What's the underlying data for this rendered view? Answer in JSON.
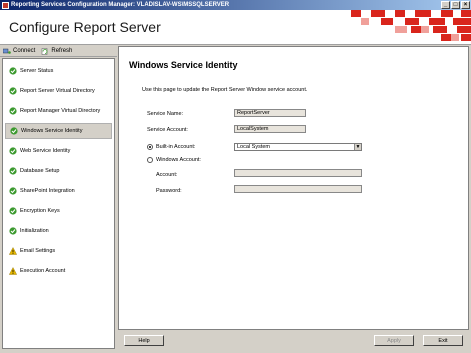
{
  "window": {
    "title": "Reporting Services Configuration Manager: VLADISLAV-WS\\MSSQLSERVER",
    "controls": {
      "minimize": "_",
      "maximize": "□",
      "close": "×"
    }
  },
  "header": {
    "title": "Configure Report Server"
  },
  "toolbar": {
    "connect_label": "Connect",
    "refresh_label": "Refresh"
  },
  "sidebar": {
    "items": [
      {
        "label": "Server Status",
        "icon": "check-icon",
        "status": "ok"
      },
      {
        "label": "Report Server Virtual Directory",
        "icon": "check-icon",
        "status": "ok"
      },
      {
        "label": "Report Manager Virtual Directory",
        "icon": "check-icon",
        "status": "ok"
      },
      {
        "label": "Windows Service Identity",
        "icon": "check-icon",
        "status": "ok",
        "active": true
      },
      {
        "label": "Web Service Identity",
        "icon": "check-icon",
        "status": "ok"
      },
      {
        "label": "Database Setup",
        "icon": "check-icon",
        "status": "ok"
      },
      {
        "label": "SharePoint Integration",
        "icon": "check-icon",
        "status": "ok"
      },
      {
        "label": "Encryption Keys",
        "icon": "check-icon",
        "status": "ok"
      },
      {
        "label": "Initialization",
        "icon": "check-icon",
        "status": "ok"
      },
      {
        "label": "Email Settings",
        "icon": "warning-icon",
        "status": "warning"
      },
      {
        "label": "Execution Account",
        "icon": "warning-icon",
        "status": "warning"
      }
    ]
  },
  "main": {
    "title": "Windows Service Identity",
    "description": "Use this page to update the Report Server Window service account.",
    "service_name_label": "Service Name:",
    "service_name_value": "ReportServer",
    "service_account_label": "Service Account:",
    "service_account_value": "LocalSystem",
    "builtin_label": "Built-in Account:",
    "builtin_value": "Local System",
    "windows_label": "Windows Account:",
    "account_label": "Account:",
    "account_value": "",
    "password_label": "Password:",
    "password_value": "",
    "selected_option": "builtin"
  },
  "buttons": {
    "help": "Help",
    "apply": "Apply",
    "exit": "Exit"
  },
  "colors": {
    "ok": "#3c9a2f",
    "warning": "#e6b800",
    "accent": "#d9251c"
  }
}
